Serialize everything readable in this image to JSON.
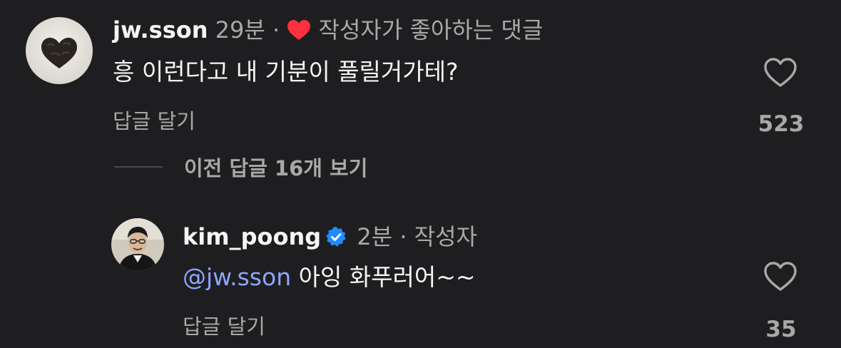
{
  "comment1": {
    "username": "jw.sson",
    "time": "29분",
    "separator": "·",
    "liked_by_author": "작성자가 좋아하는 댓글",
    "text": "흥 이런다고 내 기분이 풀릴거가테?",
    "reply_label": "답글 달기",
    "like_count": "523",
    "colors": {
      "liked_heart": "#ff3040"
    },
    "icons": {
      "avatar": "heart-chocolate-avatar",
      "like": "heart-outline-icon",
      "liked": "heart-filled-icon"
    }
  },
  "view_previous": {
    "label": "이전 답글 16개 보기"
  },
  "reply1": {
    "username": "kim_poong",
    "verified": true,
    "time": "2분",
    "separator": "·",
    "author_tag": "작성자",
    "mention": "@jw.sson",
    "text": " 아잉 화푸러어~~",
    "reply_label": "답글 달기",
    "like_count": "35",
    "colors": {
      "verified_badge": "#1f8cff",
      "mention": "#8ea5ff"
    },
    "icons": {
      "avatar": "person-photo-avatar",
      "like": "heart-outline-icon",
      "verified": "verified-badge-icon"
    }
  }
}
